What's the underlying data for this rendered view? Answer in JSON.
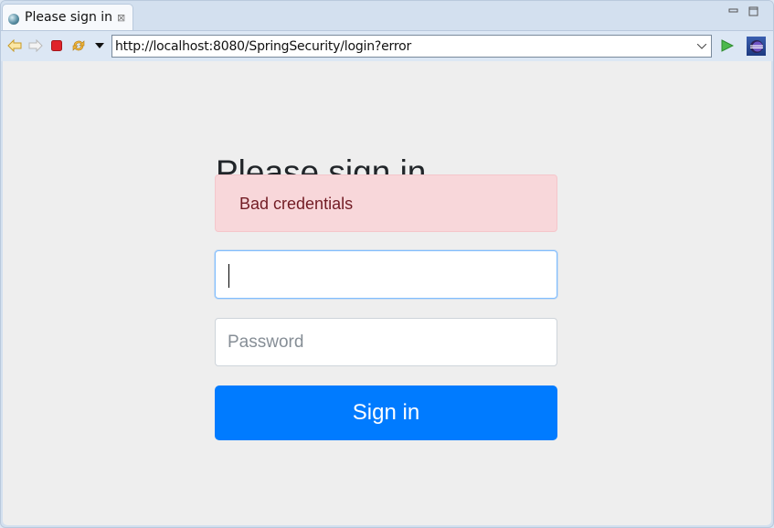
{
  "browser": {
    "tab": {
      "title": "Please sign in",
      "close_icon": "close-icon",
      "favicon": "globe-icon"
    },
    "window_controls": {
      "minimize": "▭",
      "maximize": "□"
    },
    "toolbar": {
      "back_icon": "back-arrow-icon",
      "forward_icon": "forward-arrow-icon",
      "stop_icon": "stop-icon",
      "refresh_icon": "refresh-icon",
      "menu_icon": "dropdown-triangle-icon",
      "url": "http://localhost:8080/SpringSecurity/login?error",
      "url_chevron": "⌄",
      "go_icon": "go-play-icon",
      "eclipse_icon": "eclipse-icon"
    }
  },
  "page": {
    "heading": "Please sign in",
    "alert": {
      "text": "Bad credentials",
      "background": "#f8d7da",
      "color": "#721c24"
    },
    "username": {
      "value": "",
      "placeholder": ""
    },
    "password": {
      "value": "",
      "placeholder": "Password"
    },
    "submit_label": "Sign in",
    "accent_color": "#007bff"
  }
}
